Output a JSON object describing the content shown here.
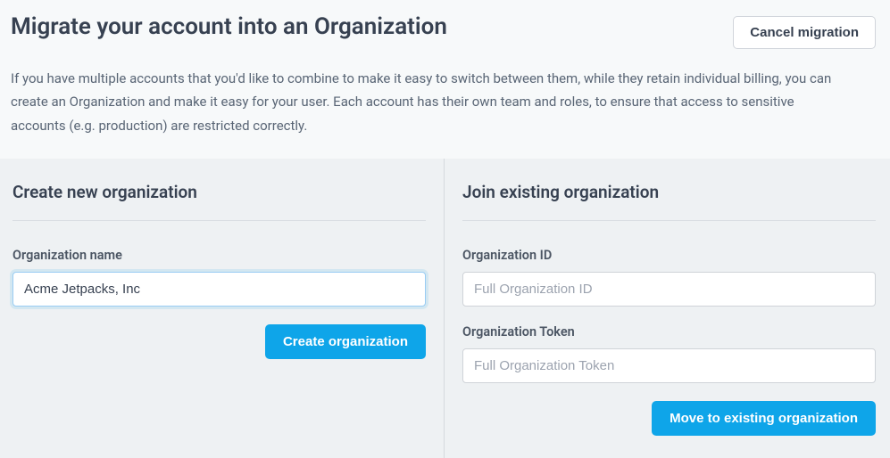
{
  "header": {
    "title": "Migrate your account into an Organization",
    "cancel_label": "Cancel migration",
    "intro": "If you have multiple accounts that you'd like to combine to make it easy to switch between them, while they retain individual billing, you can create an Organization and make it easy for your user. Each account has their own team and roles, to ensure that access to sensitive accounts (e.g. production) are restricted correctly."
  },
  "create": {
    "section_title": "Create new organization",
    "name_label": "Organization name",
    "name_value": "Acme Jetpacks, Inc",
    "submit_label": "Create organization"
  },
  "join": {
    "section_title": "Join existing organization",
    "id_label": "Organization ID",
    "id_placeholder": "Full Organization ID",
    "id_value": "",
    "token_label": "Organization Token",
    "token_placeholder": "Full Organization Token",
    "token_value": "",
    "submit_label": "Move to existing organization"
  }
}
